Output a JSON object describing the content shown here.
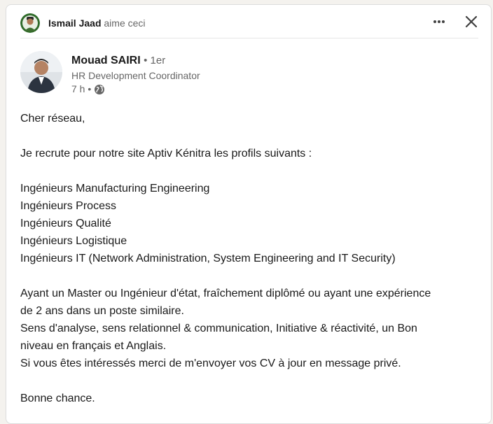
{
  "social_header": {
    "liker_name": "Ismail Jaad",
    "liker_action": "aime ceci"
  },
  "post": {
    "author": {
      "name": "Mouad SAIRI",
      "degree": "• 1er",
      "headline": "HR Development Coordinator",
      "time": "7 h •"
    },
    "body_lines": [
      "Cher réseau,",
      "",
      "Je recrute pour notre site Aptiv Kénitra les profils suivants :",
      "",
      "Ingénieurs Manufacturing Engineering",
      "Ingénieurs Process",
      "Ingénieurs Qualité",
      "Ingénieurs Logistique",
      "Ingénieurs IT (Network Administration, System Engineering and IT Security)",
      "",
      "Ayant un Master ou Ingénieur d'état, fraîchement diplômé ou ayant une expérience",
      "de 2 ans dans un poste similaire.",
      "Sens d'analyse, sens relationnel & communication, Initiative & réactivité, un Bon",
      "niveau en français et Anglais.",
      "Si vous êtes intéressés merci de m'envoyer vos CV à jour en message privé.",
      "",
      "Bonne chance."
    ]
  },
  "icons": {
    "more": "ellipsis-icon",
    "close": "close-icon",
    "visibility": "globe-icon"
  }
}
